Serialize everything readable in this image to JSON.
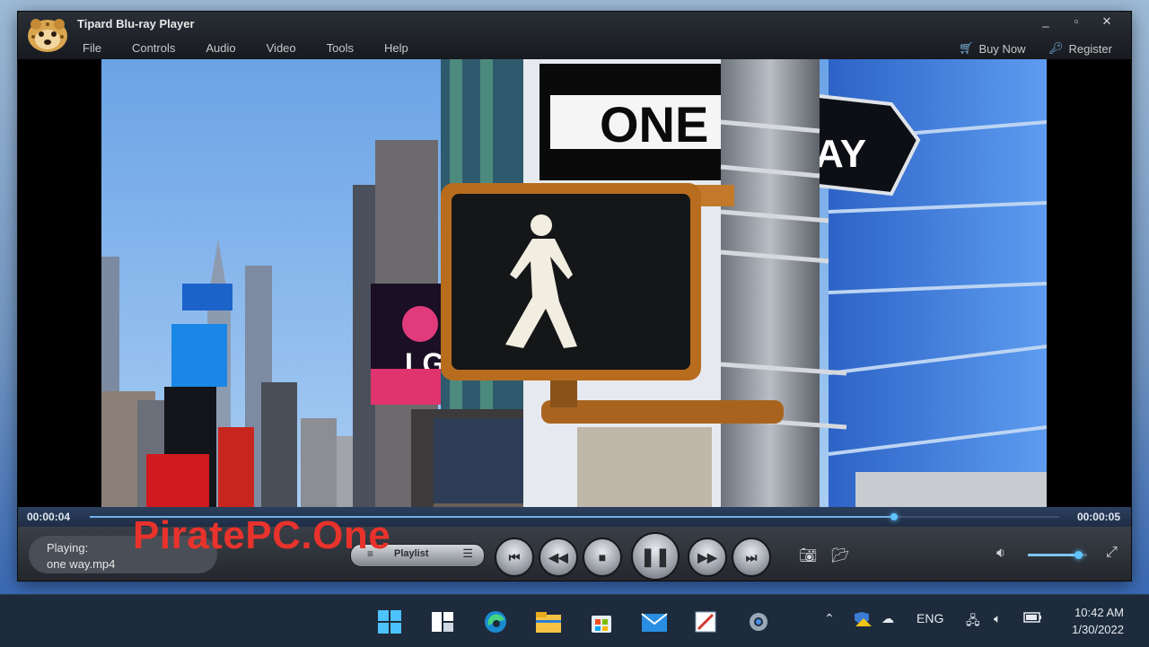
{
  "window": {
    "title": "Tipard Blu-ray Player",
    "menu": [
      "File",
      "Controls",
      "Audio",
      "Video",
      "Tools",
      "Help"
    ],
    "buy_now": "Buy Now",
    "register": "Register",
    "controls": [
      "_",
      "▫",
      "✕"
    ]
  },
  "video": {
    "sign_text": "ONE",
    "sign_text_2": "AY",
    "lg_text": "LG"
  },
  "playback": {
    "current_time": "00:00:04",
    "total_time": "00:00:05",
    "progress_fraction": 0.83,
    "playing_label": "Playing:",
    "file_name": "one way.mp4",
    "playlist_label": "Playlist",
    "volume_fraction": 0.85
  },
  "watermark": "PiratePC.One",
  "taskbar": {
    "language": "ENG",
    "time": "10:42 AM",
    "date": "1/30/2022"
  },
  "colors": {
    "accent": "#5ec3ff",
    "watermark": "#e8322c",
    "taskbar": "#1e2b3c"
  }
}
